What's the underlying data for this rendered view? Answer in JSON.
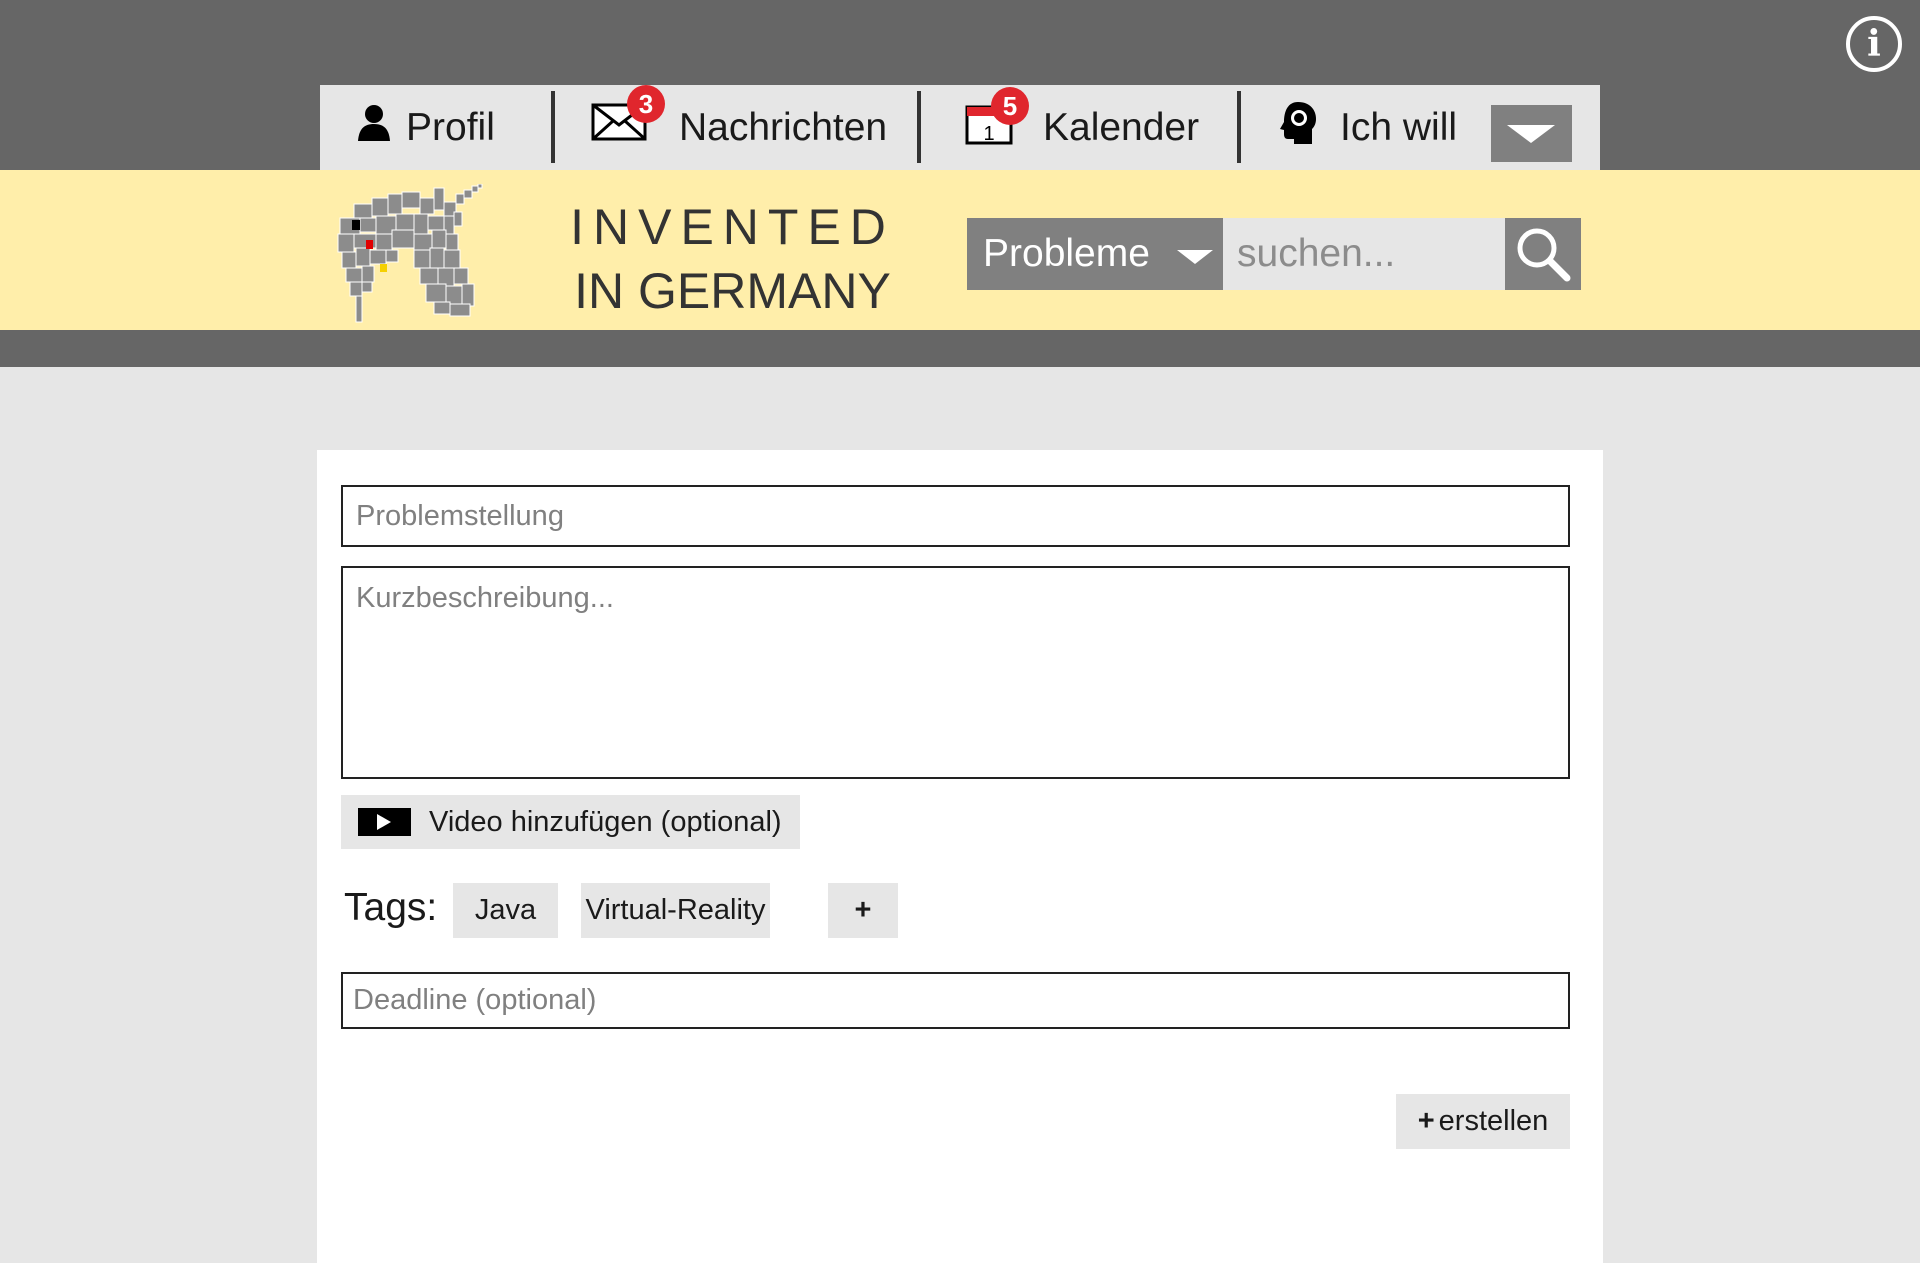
{
  "nav": {
    "items": [
      {
        "label": "Profil",
        "icon": "user-icon"
      },
      {
        "label": "Nachrichten",
        "icon": "envelope-icon",
        "badge": "3"
      },
      {
        "label": "Kalender",
        "icon": "calendar-icon",
        "badge": "5",
        "icon_day": "1"
      },
      {
        "label": "Ich will",
        "icon": "head-idea-icon"
      }
    ],
    "dropdown_icon": "chevron-down-icon"
  },
  "info_icon": "info-icon",
  "info_label": "i",
  "brand": {
    "line1": "INVENTED",
    "line2": "IN GERMANY",
    "logo": "unicorn-pixel-logo"
  },
  "search": {
    "category": "Probleme",
    "placeholder": "suchen...",
    "icon": "search-icon"
  },
  "form": {
    "problem_placeholder": "Problemstellung",
    "description_placeholder": "Kurzbeschreibung...",
    "video_label": "Video hinzufügen (optional)",
    "video_icon": "play-icon",
    "tags_label": "Tags:",
    "tags": [
      "Java",
      "Virtual-Reality"
    ],
    "add_tag_label": "+",
    "deadline_placeholder": "Deadline (optional)",
    "create_plus": "+",
    "create_label": "erstellen"
  },
  "colors": {
    "topbar": "#666666",
    "brandbar": "#ffeeaa",
    "badge": "#e0262d",
    "button_grey": "#808080",
    "page_bg": "#e6e6e6"
  }
}
